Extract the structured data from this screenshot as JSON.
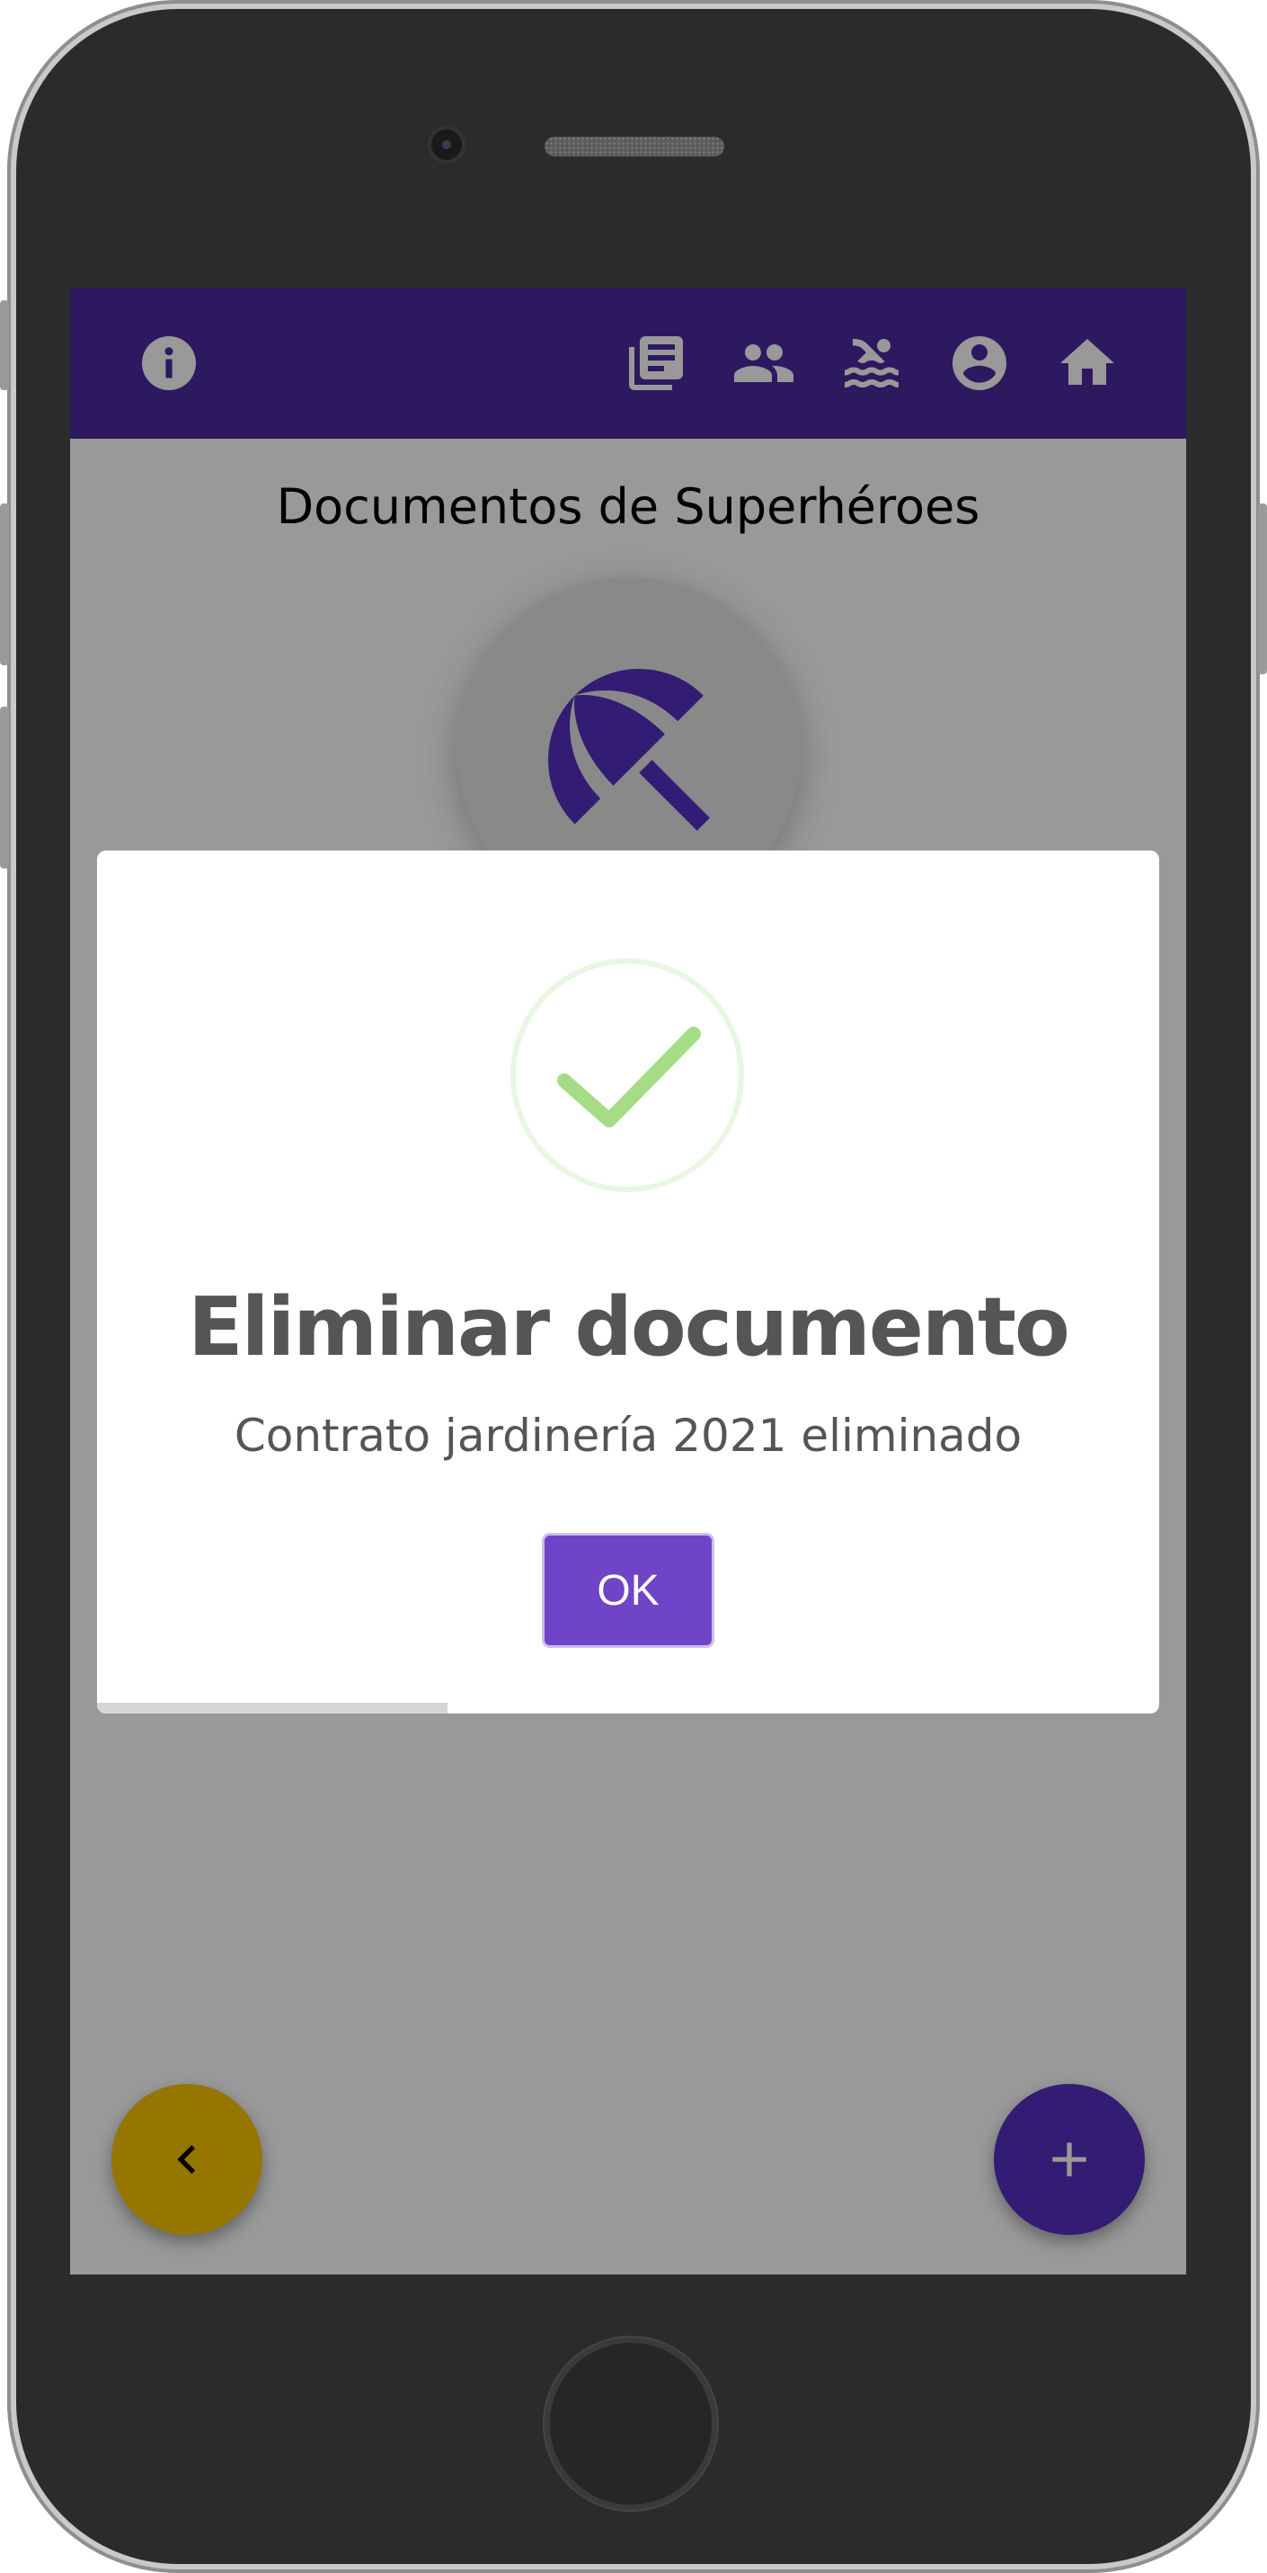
{
  "toolbar": {
    "icons": [
      {
        "name": "info-icon"
      },
      {
        "name": "documents-icon"
      },
      {
        "name": "people-icon"
      },
      {
        "name": "pool-icon"
      },
      {
        "name": "account-icon"
      },
      {
        "name": "home-icon"
      }
    ]
  },
  "page": {
    "title": "Documentos de Superhéroes",
    "avatar_icon": "beach-umbrella-icon"
  },
  "dialog": {
    "icon": "success-check-icon",
    "title": "Eliminar documento",
    "message": "Contrato jardinería 2021 eliminado",
    "ok_label": "OK",
    "timer_progress": 0.33
  },
  "fabs": {
    "back_icon": "chevron-left-icon",
    "add_icon": "plus-icon"
  },
  "colors": {
    "primary": "#4b2aa0",
    "accent": "#f7c500",
    "button": "#7044c6",
    "success": "#a5dc86"
  }
}
